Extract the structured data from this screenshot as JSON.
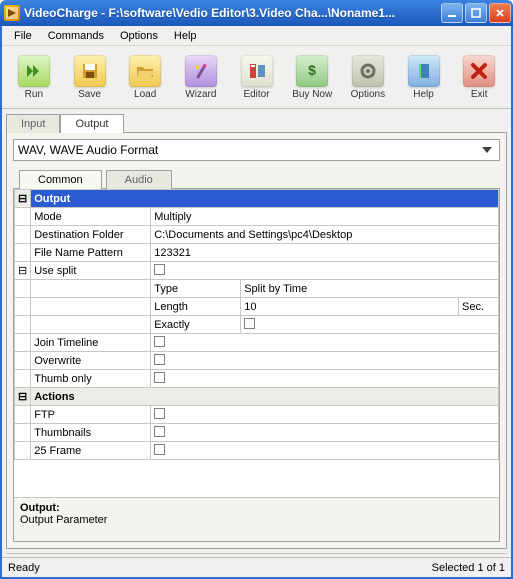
{
  "window": {
    "title": "VideoCharge - F:\\software\\Vedio Editor\\3.Video Cha...\\Noname1..."
  },
  "menu": {
    "file": "File",
    "commands": "Commands",
    "options": "Options",
    "help": "Help"
  },
  "toolbar": {
    "run": "Run",
    "save": "Save",
    "load": "Load",
    "wizard": "Wizard",
    "editor": "Editor",
    "buynow": "Buy Now",
    "options": "Options",
    "help": "Help",
    "exit": "Exit"
  },
  "tabs": {
    "input": "Input",
    "output": "Output"
  },
  "format": {
    "label": "WAV, WAVE Audio Format"
  },
  "subtabs": {
    "common": "Common",
    "audio": "Audio"
  },
  "grid": {
    "cat_output": "Output",
    "mode_k": "Mode",
    "mode_v": "Multiply",
    "dest_k": "Destination Folder",
    "dest_v": "C:\\Documents and Settings\\pc4\\Desktop",
    "fname_k": "File Name Pattern",
    "fname_v": "123321",
    "split_k": "Use split",
    "type_k": "Type",
    "type_v": "Split by Time",
    "length_k": "Length",
    "length_v": "10",
    "length_u": "Sec.",
    "exactly_k": "Exactly",
    "join_k": "Join Timeline",
    "overwrite_k": "Overwrite",
    "thumb_k": "Thumb only",
    "cat_actions": "Actions",
    "ftp_k": "FTP",
    "thumbs_k": "Thumbnails",
    "frame25_k": "25 Frame"
  },
  "desc": {
    "title": "Output:",
    "body": "Output Parameter"
  },
  "status": {
    "left": "Ready",
    "right": "Selected 1 of 1"
  }
}
